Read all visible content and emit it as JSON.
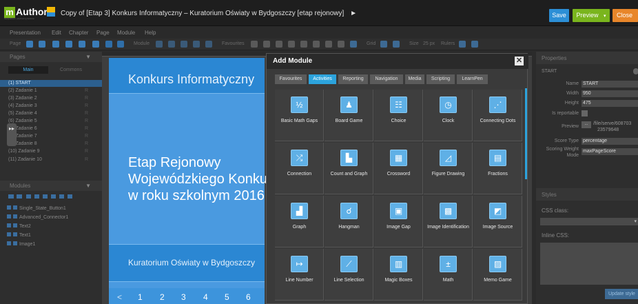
{
  "app": {
    "logo_text": "Author",
    "logo_m": "m",
    "logo_tagline": "Multiplatform eAuthoring Solution",
    "title": "Copy of [Etap 3] Konkurs Informatyczny – Kuratorium Oświaty w Bydgoszczy [etap rejonowy]",
    "title_arrow": "►",
    "save": "Save",
    "preview": "Preview",
    "close": "Close"
  },
  "menu": [
    "Presentation",
    "Edit",
    "Chapter",
    "Page",
    "Module",
    "Help"
  ],
  "toolbar": {
    "page": "Page",
    "module": "Module",
    "favourites": "Favourites",
    "grid": "Grid",
    "size": "Size",
    "size_value": "25 px",
    "rulers": "Rulers"
  },
  "pages_panel": {
    "title": "Pages",
    "tabs": [
      "Main",
      "Commons"
    ],
    "pages": [
      "(1) START",
      "(2) Zadanie 1",
      "(3) Zadanie 2",
      "(4) Zadanie 3",
      "(5) Zadanie 4",
      "(6) Zadanie 5",
      "(7) Zadanie 6",
      "(8) Zadanie 7",
      "(9) Zadanie 8",
      "(10) Zadanie 9",
      "(11) Zadanie 10"
    ],
    "page_suffix": "R"
  },
  "modules_panel": {
    "title": "Modules",
    "items": [
      "Single_State_Button1",
      "Advanced_Connector1",
      "Text2",
      "Text1",
      "Image1"
    ]
  },
  "slide": {
    "header": "Konkurs Informatyczny",
    "line1": "Etap Rejonowy",
    "line2": "Wojewódzkiego Konku",
    "line3": "w roku szkolnym 2016",
    "footer": "Kuratorium Oświaty w Bydgoszczy",
    "pager_prev": "<",
    "pages": [
      "1",
      "2",
      "3",
      "4",
      "5",
      "6"
    ]
  },
  "add_module": {
    "title": "Add Module",
    "close": "✕",
    "tabs": [
      "Favourites",
      "Activities",
      "Reporting",
      "Navigation",
      "Media",
      "Scripting",
      "LearnPen"
    ],
    "active_tab": "Activities",
    "modules": [
      {
        "label": "Basic Math Gaps",
        "glyph": "½"
      },
      {
        "label": "Board Game",
        "glyph": "♟"
      },
      {
        "label": "Choice",
        "glyph": "☷"
      },
      {
        "label": "Clock",
        "glyph": "◷"
      },
      {
        "label": "Connecting Dots",
        "glyph": "⋰"
      },
      {
        "label": "Connection",
        "glyph": "⤮"
      },
      {
        "label": "Count and Graph",
        "glyph": "▙"
      },
      {
        "label": "Crossword",
        "glyph": "▦"
      },
      {
        "label": "Figure Drawing",
        "glyph": "◿"
      },
      {
        "label": "Fractions",
        "glyph": "▤"
      },
      {
        "label": "Graph",
        "glyph": "▟"
      },
      {
        "label": "Hangman",
        "glyph": "☌"
      },
      {
        "label": "Image Gap",
        "glyph": "▣"
      },
      {
        "label": "Image Identification",
        "glyph": "▩"
      },
      {
        "label": "Image Source",
        "glyph": "◩"
      },
      {
        "label": "Line Number",
        "glyph": "↦"
      },
      {
        "label": "Line Selection",
        "glyph": "⟋"
      },
      {
        "label": "Magic Boxes",
        "glyph": "▥"
      },
      {
        "label": "Math",
        "glyph": "±"
      },
      {
        "label": "Memo Game",
        "glyph": "▨"
      }
    ]
  },
  "properties": {
    "title": "Properties",
    "section": "START",
    "name_label": "Name",
    "name_value": "START",
    "width_label": "Width",
    "width_value": "950",
    "height_label": "Height",
    "height_value": "475",
    "reportable_label": "Is reportable",
    "preview_label": "Preview",
    "preview_value": "/file/serve/608703",
    "preview_value2": "23579648",
    "score_type_label": "Score Type",
    "score_type_value": "percentage",
    "scoring_weight_label": "Scoring Weight",
    "scoring_weight_label2": "Mode",
    "scoring_weight_value": "maxPageScore"
  },
  "styles": {
    "title": "Styles",
    "css_class_label": "CSS class:",
    "inline_css_label": "Inline CSS:",
    "update_button": "Update style"
  },
  "colors": {
    "accent": "#2ca3dc",
    "save": "#2c8fd6",
    "preview": "#7ab51d",
    "close": "#e8862a"
  }
}
